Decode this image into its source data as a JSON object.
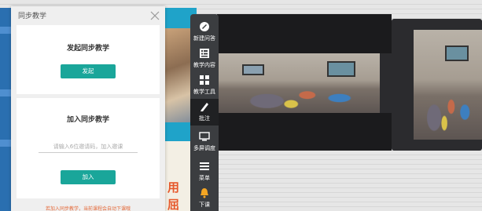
{
  "dialog": {
    "title": "同步教学",
    "start": {
      "heading": "发起同步教学",
      "button": "发起"
    },
    "join": {
      "heading": "加入同步教学",
      "placeholder": "请输入6位邀请码，加入邀课",
      "button": "加入"
    },
    "note": "若加入同步教学，当前课程会自动下课哦"
  },
  "toolbar": {
    "items": [
      {
        "label": "新建问答",
        "icon": "new-question-icon"
      },
      {
        "label": "教学内容",
        "icon": "teaching-content-icon"
      },
      {
        "label": "教学工具",
        "icon": "teaching-tools-icon"
      },
      {
        "label": "批注",
        "icon": "annotate-pen-icon",
        "active": true
      },
      {
        "label": "多屏调度",
        "icon": "multi-screen-icon"
      },
      {
        "label": "菜单",
        "icon": "menu-icon"
      },
      {
        "label": "下课",
        "icon": "bell-icon"
      }
    ]
  },
  "slide": {
    "chars": [
      "用",
      "屈"
    ]
  },
  "colors": {
    "accent": "#1aa69a",
    "warning": "#e46a3a",
    "toolbar": "#3b3d40",
    "slide": "#1fa3c9"
  }
}
